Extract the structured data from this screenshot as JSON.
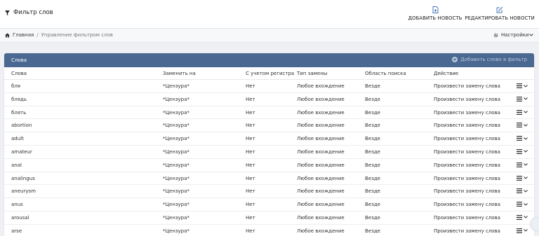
{
  "header": {
    "title": "Фильтр слов",
    "actions": [
      {
        "label": "ДОБАВИТЬ НОВОСТЬ",
        "icon": "file-plus-icon"
      },
      {
        "label": "РЕДАКТИРОВАТЬ НОВОСТИ",
        "icon": "edit-icon"
      }
    ]
  },
  "breadcrumb": {
    "home": "Главная",
    "separator": "/",
    "current": "Управление фильтром слов"
  },
  "settings_label": "Настройки",
  "panel": {
    "title": "Слова",
    "add_label": "Добавить слово в фильтр"
  },
  "table": {
    "columns": [
      "Слова",
      "Заменить на",
      "С учетом регистра",
      "Тип замены",
      "Область поиска",
      "Действие"
    ],
    "rows": [
      [
        "бля",
        "*Цензура*",
        "Нет",
        "Любое вхождение",
        "Везде",
        "Произвести замену слова"
      ],
      [
        "блядь",
        "*Цензура*",
        "Нет",
        "Любое вхождение",
        "Везде",
        "Произвести замену слова"
      ],
      [
        "блять",
        "*Цензура*",
        "Нет",
        "Любое вхождение",
        "Везде",
        "Произвести замену слова"
      ],
      [
        "abortion",
        "*Цензура*",
        "Нет",
        "Любое вхождение",
        "Везде",
        "Произвести замену слова"
      ],
      [
        "adult",
        "*Цензура*",
        "Нет",
        "Любое вхождение",
        "Везде",
        "Произвести замену слова"
      ],
      [
        "amateur",
        "*Цензура*",
        "Нет",
        "Любое вхождение",
        "Везде",
        "Произвести замену слова"
      ],
      [
        "anal",
        "*Цензура*",
        "Нет",
        "Любое вхождение",
        "Везде",
        "Произвести замену слова"
      ],
      [
        "analingus",
        "*Цензура*",
        "Нет",
        "Любое вхождение",
        "Везде",
        "Произвести замену слова"
      ],
      [
        "aneurysm",
        "*Цензура*",
        "Нет",
        "Любое вхождение",
        "Везде",
        "Произвести замену слова"
      ],
      [
        "anus",
        "*Цензура*",
        "Нет",
        "Любое вхождение",
        "Везде",
        "Произвести замену слова"
      ],
      [
        "arousal",
        "*Цензура*",
        "Нет",
        "Любое вхождение",
        "Везде",
        "Произвести замену слова"
      ],
      [
        "arse",
        "*Цензура*",
        "Нет",
        "Любое вхождение",
        "Везде",
        "Произвести замену слова"
      ]
    ]
  },
  "colors": {
    "panel_header": "#4a6891",
    "accent": "#3a6fb0"
  }
}
